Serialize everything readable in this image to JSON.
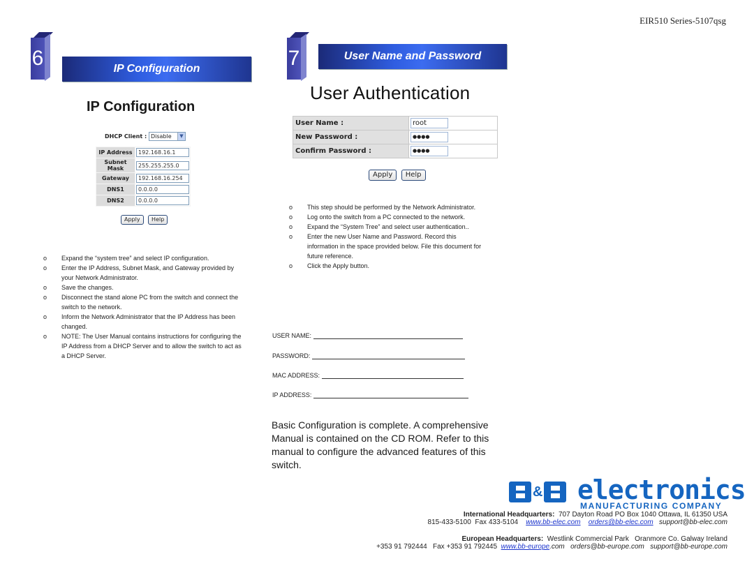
{
  "doc_id": "EIR510 Series-5107qsg",
  "section6": {
    "number": "6",
    "banner": "IP Configuration",
    "title": "IP Configuration",
    "dhcp_label": "DHCP Client :",
    "dhcp_value": "Disable",
    "fields": [
      {
        "label": "IP Address",
        "value": "192.168.16.1"
      },
      {
        "label": "Subnet Mask",
        "value": "255.255.255.0"
      },
      {
        "label": "Gateway",
        "value": "192.168.16.254"
      },
      {
        "label": "DNS1",
        "value": "0.0.0.0"
      },
      {
        "label": "DNS2",
        "value": "0.0.0.0"
      }
    ],
    "apply_label": "Apply",
    "help_label": "Help",
    "bullet_glyph": "o",
    "steps": [
      "Expand the “system tree” and select IP configuration.",
      "Enter the IP Address, Subnet Mask, and Gateway provided by your Network Administrator.",
      "Save the changes.",
      "Disconnect the stand alone PC from the switch and connect the switch to the network.",
      "Inform the Network Administrator that the IP Address has been changed.",
      "NOTE: The User Manual contains instructions for configuring the IP Address from a DHCP Server and to allow the switch to act as a DHCP Server."
    ]
  },
  "section7": {
    "number": "7",
    "banner": "User Name and Password",
    "title": "User Authentication",
    "fields": [
      {
        "label": "User Name :",
        "value": "root"
      },
      {
        "label": "New Password :",
        "value": "●●●●"
      },
      {
        "label": "Confirm Password :",
        "value": "●●●●"
      }
    ],
    "apply_label": "Apply",
    "help_label": "Help",
    "steps": [
      "This step should be performed by the Network Administrator.",
      "Log onto the switch from a PC connected to the network.",
      "Expand the “System Tree” and select user authentication..",
      "Enter the new User Name and Password. Record this information in the space provided below. File this document for future reference.",
      "Click the Apply button."
    ],
    "record_fields": [
      "USER NAME:",
      "PASSWORD:",
      "MAC ADDRESS:",
      "IP ADDRESS:"
    ],
    "summary": "Basic Configuration is complete. A comprehensive Manual is contained on the CD ROM. Refer to this manual to configure the advanced features of this switch."
  },
  "footer": {
    "logo": {
      "amp": "&",
      "word": "electronics",
      "sub": "MANUFACTURING COMPANY",
      "color": "#1565c0"
    },
    "intl": {
      "label": "International Headquarters:",
      "address": "707 Dayton Road PO Box 1040 Ottawa, IL 61350 USA",
      "phone": "815-433-5100",
      "fax": "Fax 433-5104",
      "web": "www.bb-elec.com",
      "orders": "orders@bb-elec.com",
      "support": "support@bb-elec.com"
    },
    "euro": {
      "label": "European Headquarters:",
      "address": "Westlink Commercial Park   Oranmore Co. Galway Ireland",
      "phone": "+353 91 792444",
      "fax": "Fax +353 91 792445",
      "web": "www.bb-europe",
      "web_suffix": ".com",
      "orders": "orders@bb-europe.com",
      "support": "support@bb-europe.com"
    }
  }
}
